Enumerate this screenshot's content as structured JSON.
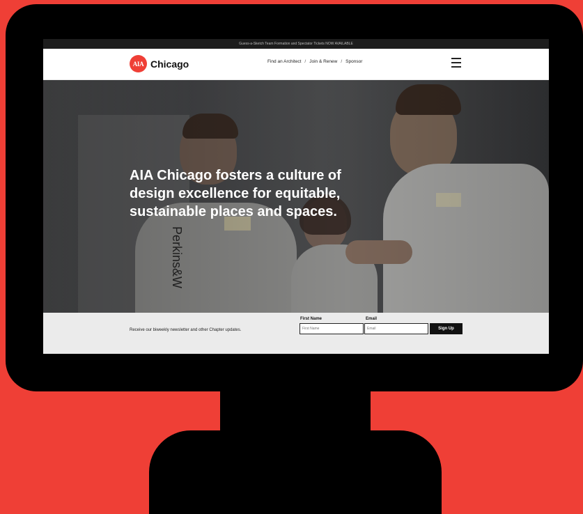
{
  "announcement": {
    "text": "Guess-a-Sketch Team Formation and Spectator Tickets NOW AVAILABLE"
  },
  "header": {
    "logo_mark": "AIA",
    "logo_text": "Chicago",
    "nav_links": [
      "Find an Architect",
      "Join & Renew",
      "Sponsor"
    ],
    "nav_separator": "/",
    "menu_icon": "hamburger-menu-icon"
  },
  "hero": {
    "headline": "AIA Chicago fosters a culture of design excellence for equitable, sustainable places and spaces.",
    "shirt_text": "Perkins&W"
  },
  "newsletter": {
    "prompt": "Receive our biweekly newsletter and other Chapter updates.",
    "first_name_label": "First Name",
    "first_name_placeholder": "First Name",
    "email_label": "Email",
    "email_placeholder": "Email",
    "submit_label": "Sign Up"
  },
  "colors": {
    "brand_red": "#ef3f36",
    "frame": "#000000",
    "top_bar": "#1d1d1d",
    "button": "#111111"
  }
}
